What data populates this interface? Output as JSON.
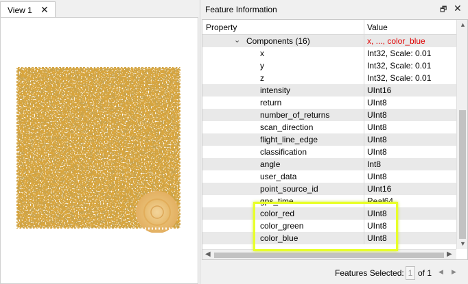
{
  "view_tab": {
    "label": "View 1",
    "close": "✕"
  },
  "panel": {
    "title": "Feature Information",
    "pin": "🗗",
    "close": "✕"
  },
  "grid": {
    "headers": {
      "property": "Property",
      "value": "Value"
    },
    "group": {
      "label": "Components (16)",
      "value": "x, ..., color_blue"
    },
    "rows": [
      {
        "property": "x",
        "value": "Int32, Scale: 0.01"
      },
      {
        "property": "y",
        "value": "Int32, Scale: 0.01"
      },
      {
        "property": "z",
        "value": "Int32, Scale: 0.01"
      },
      {
        "property": "intensity",
        "value": "UInt16"
      },
      {
        "property": "return",
        "value": "UInt8"
      },
      {
        "property": "number_of_returns",
        "value": "UInt8"
      },
      {
        "property": "scan_direction",
        "value": "UInt8"
      },
      {
        "property": "flight_line_edge",
        "value": "UInt8"
      },
      {
        "property": "classification",
        "value": "UInt8"
      },
      {
        "property": "angle",
        "value": "Int8"
      },
      {
        "property": "user_data",
        "value": "UInt8"
      },
      {
        "property": "point_source_id",
        "value": "UInt16"
      },
      {
        "property": "gps_time",
        "value": "Real64"
      },
      {
        "property": "color_red",
        "value": "UInt8"
      },
      {
        "property": "color_green",
        "value": "UInt8"
      },
      {
        "property": "color_blue",
        "value": "UInt8"
      }
    ]
  },
  "footer": {
    "label": "Features Selected:",
    "page": "1",
    "of": "of 1"
  },
  "colors": {
    "highlight": "#e8ff2a",
    "group_value": "#e00000",
    "point_cloud": "#d9a53c"
  }
}
